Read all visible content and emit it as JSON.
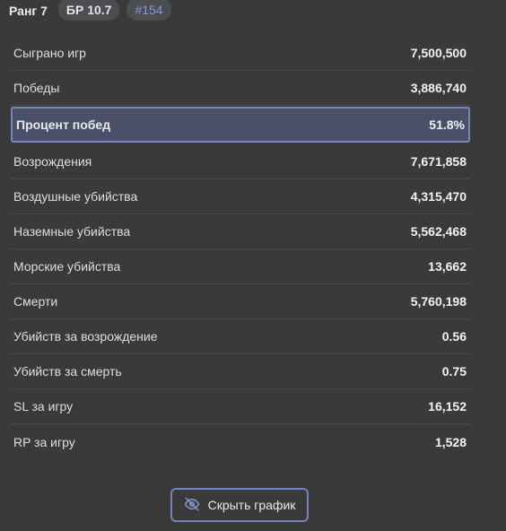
{
  "header": {
    "rank_label": "Ранг 7",
    "br_label": "БР 10.7",
    "place_label": "#154"
  },
  "stats": [
    {
      "label": "Сыграно игр",
      "value": "7,500,500"
    },
    {
      "label": "Победы",
      "value": "3,886,740"
    },
    {
      "label": "Процент побед",
      "value": "51.8%",
      "highlight": true
    },
    {
      "label": "Возрождения",
      "value": "7,671,858"
    },
    {
      "label": "Воздушные убийства",
      "value": "4,315,470"
    },
    {
      "label": "Наземные убийства",
      "value": "5,562,468"
    },
    {
      "label": "Морские убийства",
      "value": "13,662"
    },
    {
      "label": "Смерти",
      "value": "5,760,198"
    },
    {
      "label": "Убийств за возрождение",
      "value": "0.56"
    },
    {
      "label": "Убийств за смерть",
      "value": "0.75"
    },
    {
      "label": "SL за игру",
      "value": "16,152"
    },
    {
      "label": "RP за игру",
      "value": "1,528"
    }
  ],
  "footer": {
    "hide_chart_label": "Скрыть график",
    "hide_icon": "eye-slash-icon"
  },
  "colors": {
    "background": "#3a3a3a",
    "accent": "#7683ba",
    "highlight_bg": "#4a5068",
    "place_text": "#8a97d6"
  }
}
